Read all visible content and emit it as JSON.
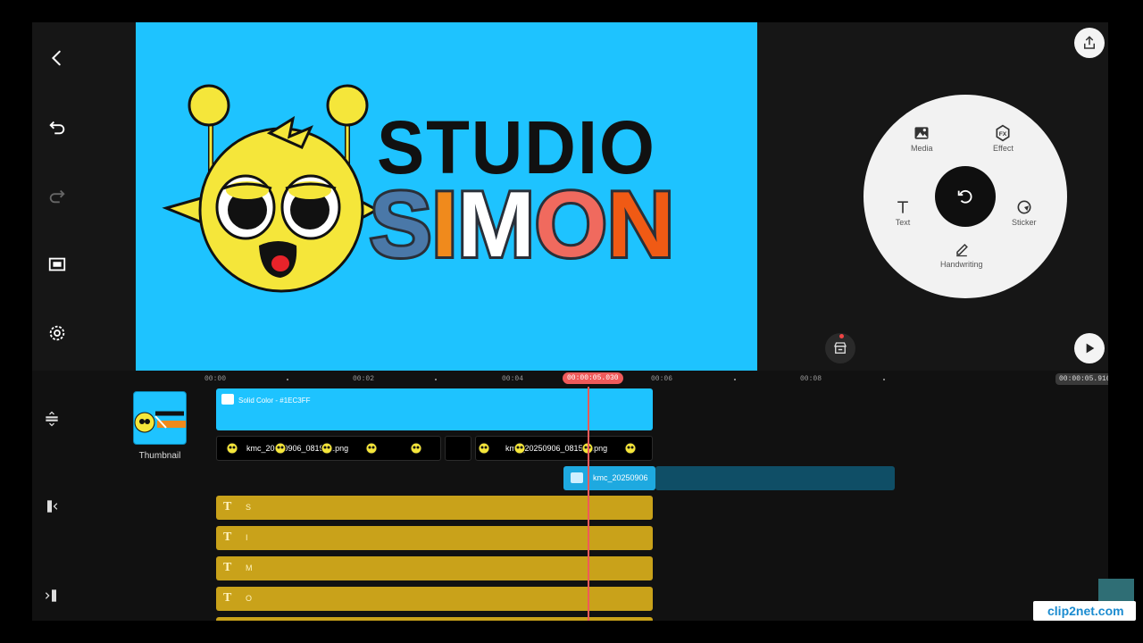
{
  "toolbar": {
    "back": "back-icon",
    "undo": "undo-icon",
    "redo": "redo-icon",
    "fullscreen": "fullscreen-icon",
    "settings": "gear-icon"
  },
  "preview": {
    "background": "#1EC3FF",
    "logo_line1": "STUDIO",
    "logo_line2_letters": [
      {
        "ch": "S",
        "color": "#4a78a8"
      },
      {
        "ch": "I",
        "color": "#f08a1c"
      },
      {
        "ch": "M",
        "color": "#ffffff"
      },
      {
        "ch": "O",
        "color": "#f06a5e"
      },
      {
        "ch": "N",
        "color": "#f05a14"
      }
    ]
  },
  "radial_menu": {
    "media": "Media",
    "effect": "Effect",
    "text": "Text",
    "sticker": "Sticker",
    "handwriting": "Handwriting",
    "effect_badge": "FX"
  },
  "timeline": {
    "ticks": [
      "00:00",
      "00:02",
      "00:04",
      "00:06",
      "00:08"
    ],
    "current_time": "00:00:05.030",
    "total_time": "00:00:05.916",
    "thumbnail_label": "Thumbnail",
    "solid_color_label": "Solid Color - #1EC3FF",
    "image_clip_1": "kmc_20250906_081951.png",
    "image_clip_2": "kmc_20250906_081528.png",
    "overlay_clip": "kmc_20250906",
    "text_layers": [
      "S",
      "I",
      "M",
      "O"
    ]
  },
  "watermark": {
    "text": "clip2net.com"
  }
}
